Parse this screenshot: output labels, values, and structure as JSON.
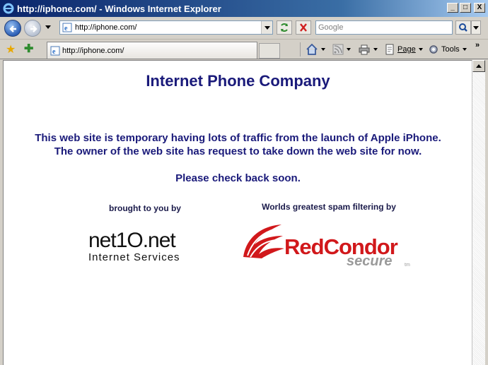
{
  "window": {
    "title": "http://iphone.com/ - Windows Internet Explorer",
    "minimize": "_",
    "maximize": "□",
    "close": "X"
  },
  "navbar": {
    "address": "http://iphone.com/",
    "search_placeholder": "Google"
  },
  "tabbar": {
    "tab_title": "http://iphone.com/",
    "page_label": "Page",
    "tools_label": "Tools",
    "chevron": "»"
  },
  "content": {
    "heading": "Internet Phone Company",
    "message_line1": "This web site is temporary having lots of traffic from the launch of Apple iPhone.",
    "message_line2": "The owner of the web site has request to take down the web site for now.",
    "check_back": "Please check back soon.",
    "brought_by": "brought to you by",
    "worlds_greatest": "Worlds greatest spam filtering by",
    "net10_logo": "net1O.net",
    "net10_sub": "Internet Services",
    "redcondor_logo": "RedCondor",
    "redcondor_secure": "secure",
    "redcondor_tm": "tm"
  },
  "colors": {
    "heading": "#1a1a7a",
    "brand_red": "#d1181b"
  }
}
